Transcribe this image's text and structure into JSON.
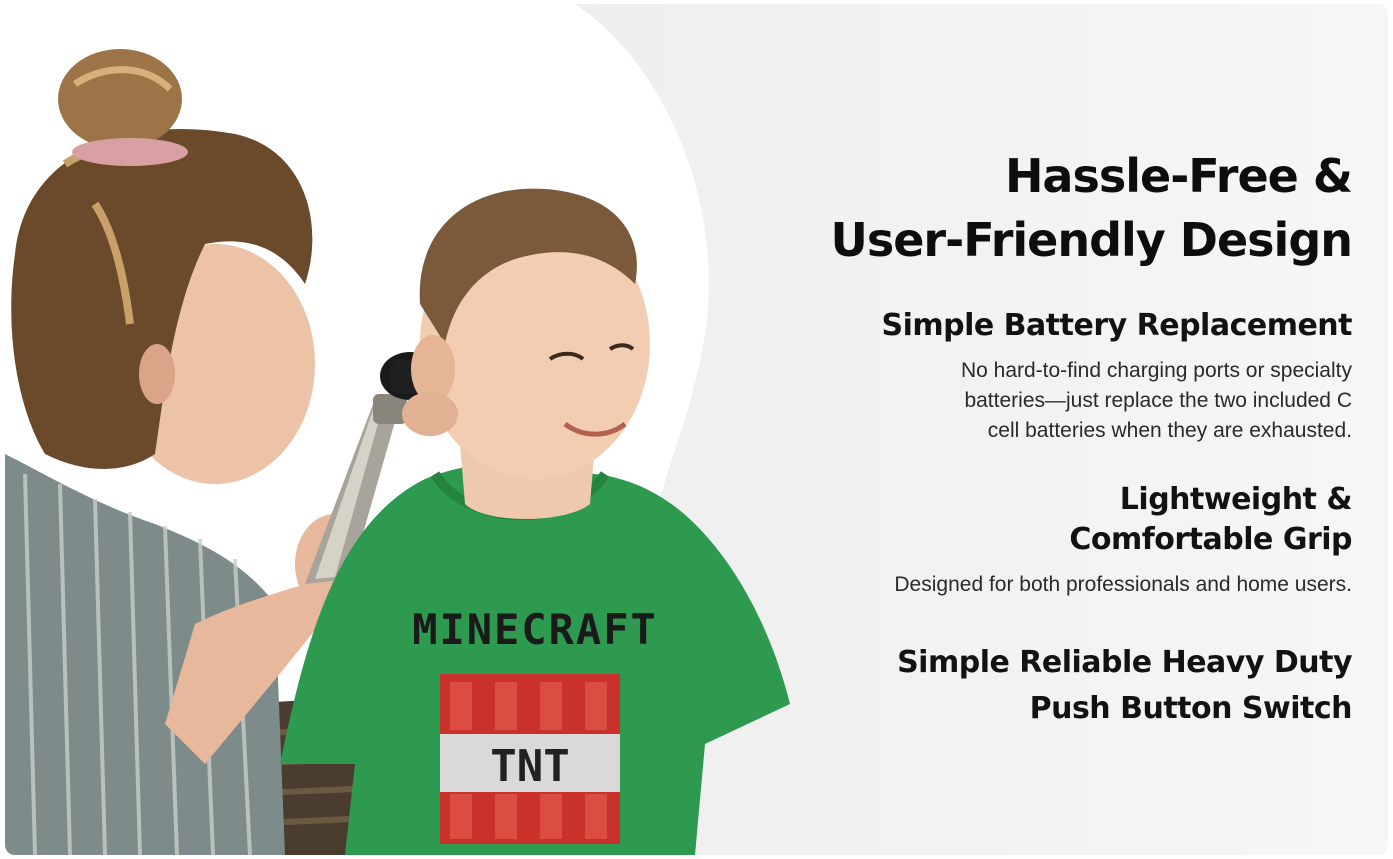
{
  "headline": {
    "line1": "Hassle-Free &",
    "line2": "User-Friendly Design"
  },
  "features": [
    {
      "title_lines": [
        "Simple Battery Replacement"
      ],
      "description_lines": [
        "No hard-to-find charging ports or specialty",
        "batteries—just replace the two included C",
        "cell batteries when they are exhausted."
      ]
    },
    {
      "title_lines": [
        "Lightweight &",
        "Comfortable Grip"
      ],
      "description_lines": [
        "Designed for both professionals and home users."
      ]
    },
    {
      "title_lines": [
        "Simple Reliable Heavy Duty",
        "Push Button Switch"
      ],
      "description_lines": []
    }
  ],
  "photo": {
    "shirt_text": "MINECRAFT",
    "block_text": "TNT"
  },
  "colors": {
    "background": "#efefef",
    "wave": "#ffffff",
    "heading": "#0d0d0d",
    "body_text": "#2a2a2a",
    "shirt": "#2e9a4f"
  }
}
